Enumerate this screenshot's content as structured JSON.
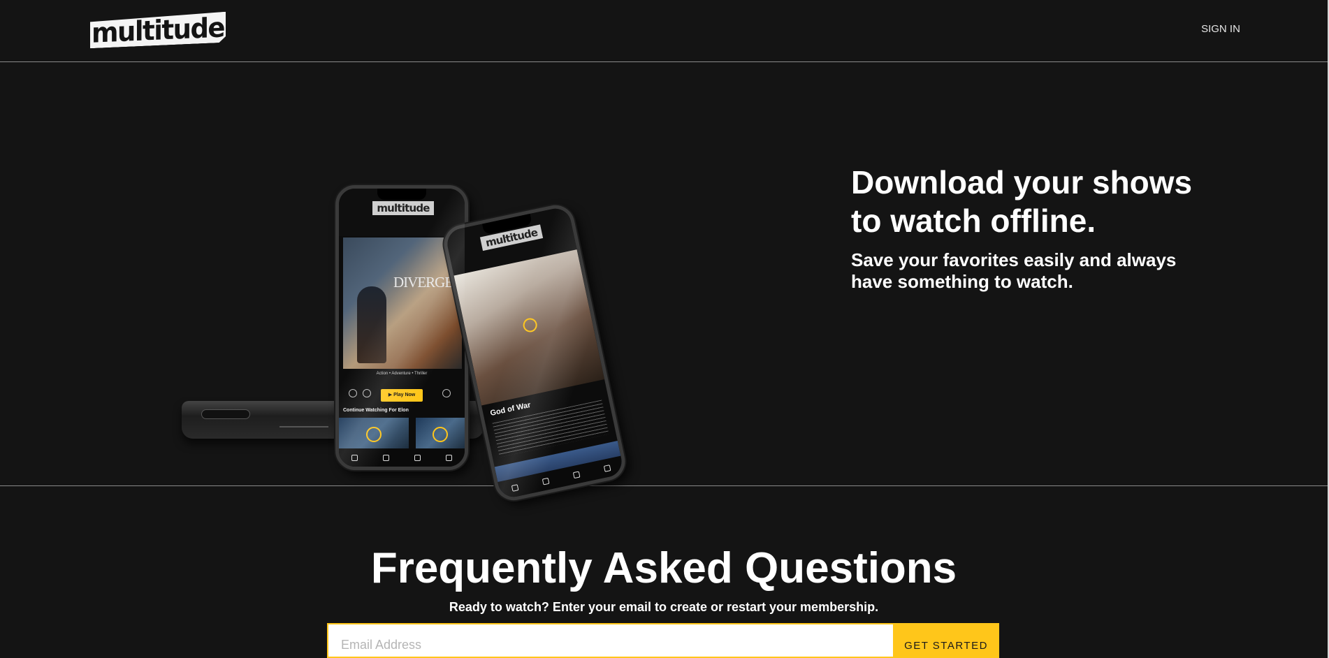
{
  "header": {
    "logo_text": "multitude",
    "sign_in_label": "SIGN IN"
  },
  "hero": {
    "title": "Download your shows to watch offline.",
    "subtitle": "Save your favorites easily and always have something to watch.",
    "phone_front": {
      "poster_title": "DIVERGENT",
      "genres": "Action • Adventure • Thriller",
      "play_label": "▶ Play Now",
      "continue_label": "Continue Watching For Elon"
    },
    "phone_back": {
      "title": "God of War"
    }
  },
  "faq": {
    "title": "Frequently Asked Questions",
    "cta_text": "Ready to watch? Enter your email to create or restart your membership.",
    "email_placeholder": "Email Address",
    "get_started_label": "GET STARTED"
  },
  "colors": {
    "background": "#141414",
    "accent": "#ffc61a",
    "text": "#ffffff",
    "divider": "#8a8a8a"
  }
}
